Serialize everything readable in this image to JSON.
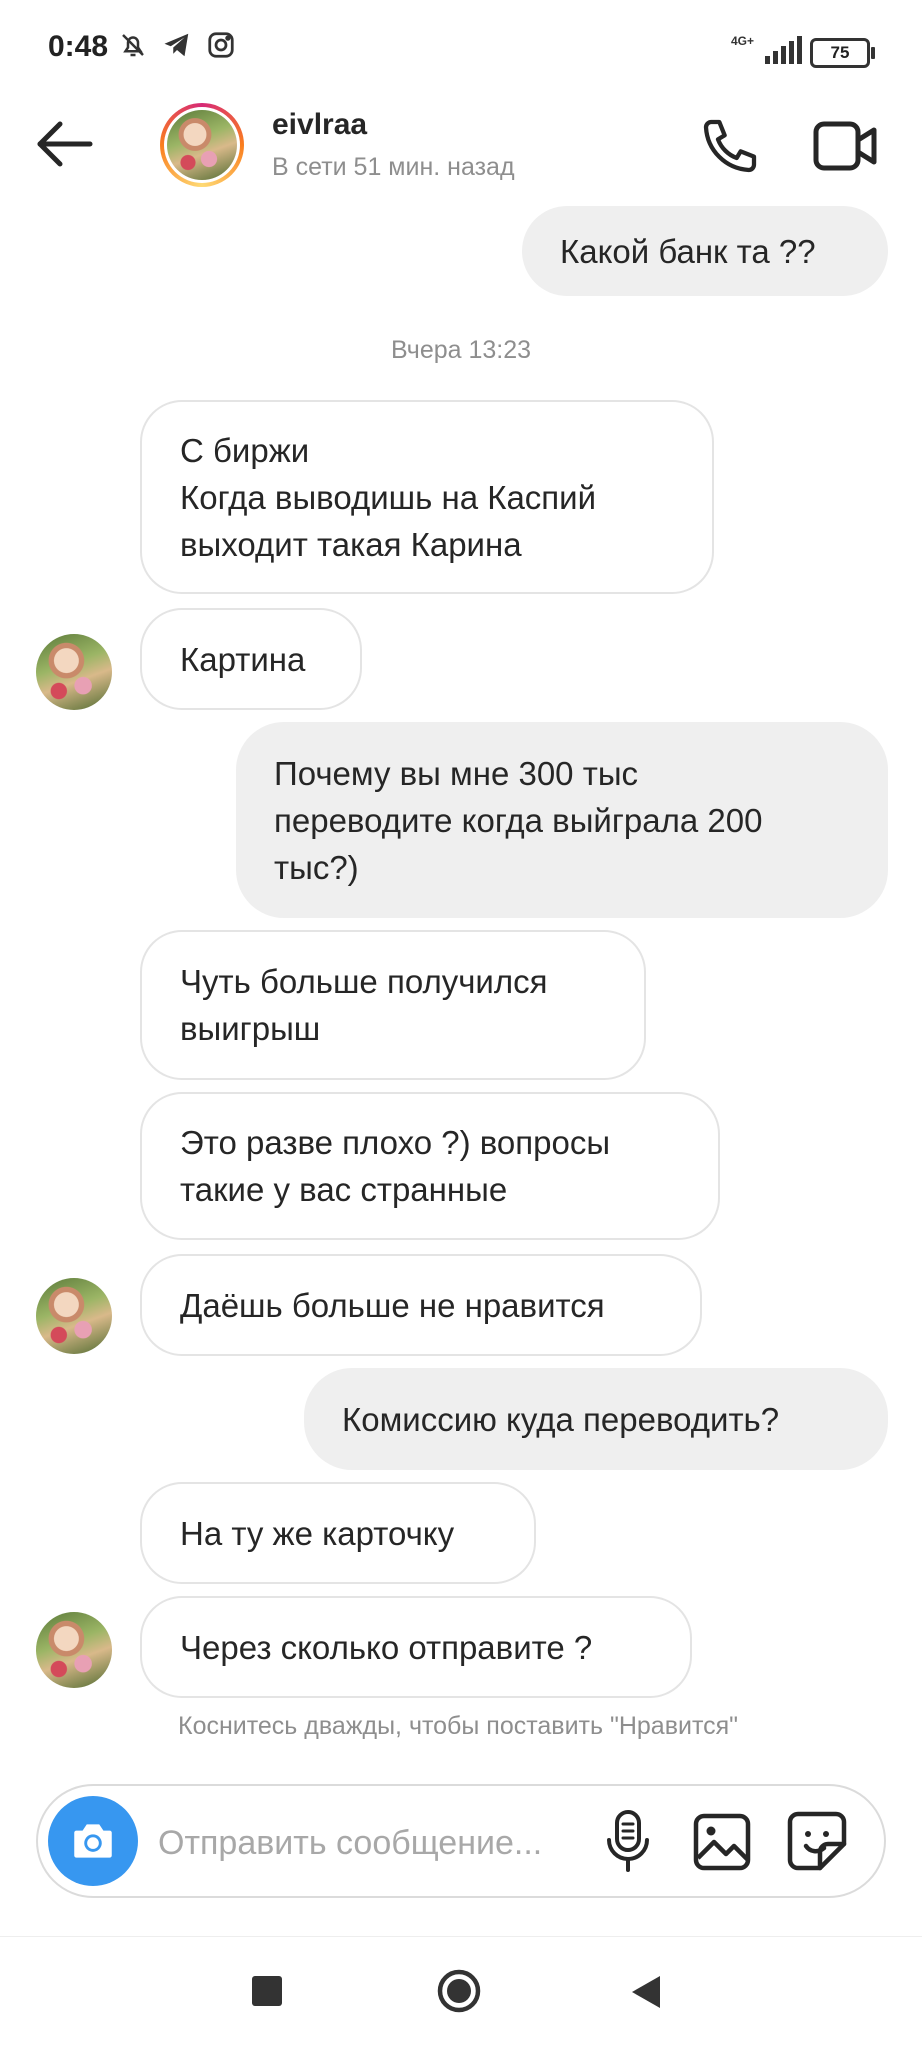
{
  "status_bar": {
    "time": "0:48",
    "network": "4G+",
    "battery": "75"
  },
  "header": {
    "username": "eivlraa",
    "presence": "В сети 51 мин. назад"
  },
  "messages": [
    {
      "direction": "out",
      "text": "Какой банк та ??"
    },
    {
      "direction": "in",
      "text": "С биржи\nКогда выводишь на Каспий\nвыходит такая Карина"
    },
    {
      "direction": "in",
      "text": "Картина"
    },
    {
      "direction": "out",
      "text": "Почему вы мне 300 тыс\nпереводите когда выйграла 200\nтыс?)"
    },
    {
      "direction": "in",
      "text": "Чуть больше получился\nвыигрыш"
    },
    {
      "direction": "in",
      "text": "Это разве плохо ?) вопросы\nтакие у вас странные"
    },
    {
      "direction": "in",
      "text": "Даёшь больше не нравится"
    },
    {
      "direction": "out",
      "text": "Комиссию куда переводить?"
    },
    {
      "direction": "in",
      "text": "На ту же карточку"
    },
    {
      "direction": "in",
      "text": "Через сколько отправите ?"
    }
  ],
  "timestamp_divider": "Вчера 13:23",
  "like_hint": "Коснитесь дважды, чтобы поставить \"Нравится\"",
  "composer": {
    "placeholder": "Отправить сообщение...",
    "accent_color": "#3797f0"
  }
}
